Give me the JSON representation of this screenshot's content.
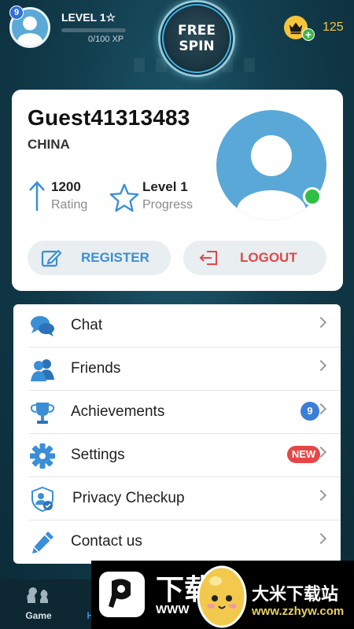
{
  "header": {
    "level_badge": "9",
    "level_title": "LEVEL 1☆",
    "xp_text": "0/100 XP",
    "xp_progress": 0.0,
    "free_spin_line1": "FREE",
    "free_spin_line2": "SPIN",
    "coins": "125",
    "crown_icon": "crown-icon",
    "plus_symbol": "+"
  },
  "profile": {
    "username": "Guest41313483",
    "country": "CHINA",
    "rating_value": "1200",
    "rating_label": "Rating",
    "progress_value": "Level 1",
    "progress_label": "Progress",
    "online": true,
    "register_label": "REGISTER",
    "logout_label": "LOGOUT"
  },
  "menu": {
    "items": [
      {
        "label": "Chat",
        "icon": "chat-icon"
      },
      {
        "label": "Friends",
        "icon": "friends-icon"
      },
      {
        "label": "Achievements",
        "icon": "trophy-icon",
        "badge": "9"
      },
      {
        "label": "Settings",
        "icon": "gear-icon",
        "badge": "NEW"
      },
      {
        "label": "Privacy Checkup",
        "icon": "shield-user-icon"
      },
      {
        "label": "Contact us",
        "icon": "pencil-icon"
      }
    ]
  },
  "bottom_nav": {
    "game_label": "Game",
    "home_label": "Home"
  },
  "watermark": {
    "big_text": "下载",
    "www_text": "WWW",
    "brand": "大米下载站",
    "url": "www.zzhyw.com"
  },
  "colors": {
    "accent_blue": "#3a8fd6",
    "logout_red": "#e04848",
    "online_green": "#2fbf47",
    "coin_gold": "#f6c53a",
    "background_teal": "#123d4d"
  }
}
